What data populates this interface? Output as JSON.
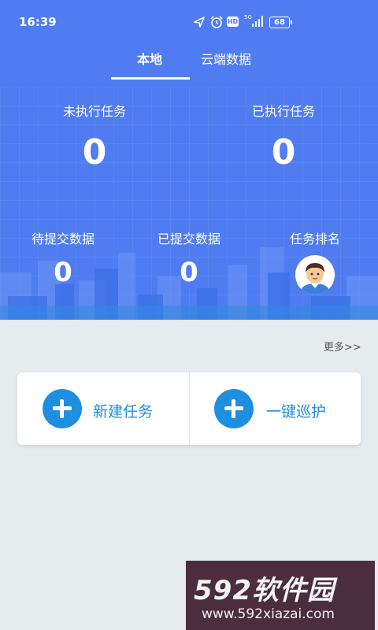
{
  "status_bar": {
    "time": "16:39",
    "battery": "68",
    "icons": [
      "location-icon",
      "alarm-icon",
      "hd-icon",
      "signal-5g-icon"
    ]
  },
  "tabs": [
    {
      "label": "本地",
      "active": true
    },
    {
      "label": "云端数据",
      "active": false
    }
  ],
  "stats_top": {
    "unexecuted_label": "未执行任务",
    "unexecuted_value": "0",
    "executed_label": "已执行任务",
    "executed_value": "0"
  },
  "stats_bottom": {
    "pending_label": "待提交数据",
    "pending_value": "0",
    "submitted_label": "已提交数据",
    "submitted_value": "0",
    "ranking_label": "任务排名"
  },
  "more_link": "更多>>",
  "actions": [
    {
      "label": "新建任务",
      "icon": "plus-circle-icon"
    },
    {
      "label": "一键巡护",
      "icon": "plus-circle-icon"
    }
  ],
  "watermark": {
    "title": "592软件园",
    "url": "www.592xiazai.com"
  },
  "colors": {
    "hero": "#4f7cf0",
    "accent": "#1e8fe0",
    "background": "#e6ebee"
  }
}
